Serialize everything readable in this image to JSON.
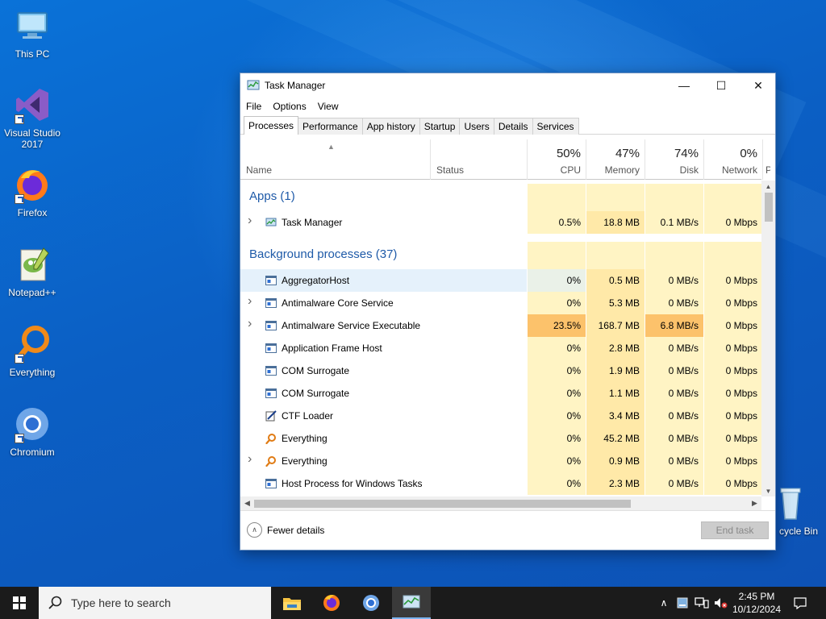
{
  "desktop": {
    "icons": [
      {
        "label": "This PC"
      },
      {
        "label": "Visual Studio 2017"
      },
      {
        "label": "Firefox"
      },
      {
        "label": "Notepad++"
      },
      {
        "label": "Everything"
      },
      {
        "label": "Chromium"
      },
      {
        "label": "cycle Bin"
      }
    ]
  },
  "window": {
    "title": "Task Manager",
    "controls": {
      "minimize": "—",
      "maximize": "☐",
      "close": "✕"
    },
    "menu": [
      "File",
      "Options",
      "View"
    ],
    "tabs": [
      "Processes",
      "Performance",
      "App history",
      "Startup",
      "Users",
      "Details",
      "Services"
    ],
    "active_tab": "Processes",
    "columns": {
      "name": "Name",
      "status": "Status",
      "cpu": {
        "pct": "50%",
        "label": "CPU"
      },
      "memory": {
        "pct": "47%",
        "label": "Memory"
      },
      "disk": {
        "pct": "74%",
        "label": "Disk"
      },
      "network": {
        "pct": "0%",
        "label": "Network"
      },
      "power_partial": "P"
    },
    "groups": {
      "apps": "Apps (1)",
      "background": "Background processes (37)"
    },
    "app_rows": [
      {
        "name": "Task Manager",
        "expandable": true,
        "icon": "taskmgr-icon",
        "cpu": "0.5%",
        "memory": "18.8 MB",
        "disk": "0.1 MB/s",
        "network": "0 Mbps"
      }
    ],
    "bg_rows": [
      {
        "name": "AggregatorHost",
        "expandable": false,
        "icon": "service-icon",
        "cpu": "0%",
        "memory": "0.5 MB",
        "disk": "0 MB/s",
        "network": "0 Mbps",
        "hover": true
      },
      {
        "name": "Antimalware Core Service",
        "expandable": true,
        "icon": "service-icon",
        "cpu": "0%",
        "memory": "5.3 MB",
        "disk": "0 MB/s",
        "network": "0 Mbps"
      },
      {
        "name": "Antimalware Service Executable",
        "expandable": true,
        "icon": "service-icon",
        "cpu": "23.5%",
        "memory": "168.7 MB",
        "disk": "6.8 MB/s",
        "network": "0 Mbps",
        "hot": true
      },
      {
        "name": "Application Frame Host",
        "expandable": false,
        "icon": "service-icon",
        "cpu": "0%",
        "memory": "2.8 MB",
        "disk": "0 MB/s",
        "network": "0 Mbps"
      },
      {
        "name": "COM Surrogate",
        "expandable": false,
        "icon": "service-icon",
        "cpu": "0%",
        "memory": "1.9 MB",
        "disk": "0 MB/s",
        "network": "0 Mbps"
      },
      {
        "name": "COM Surrogate",
        "expandable": false,
        "icon": "service-icon",
        "cpu": "0%",
        "memory": "1.1 MB",
        "disk": "0 MB/s",
        "network": "0 Mbps"
      },
      {
        "name": "CTF Loader",
        "expandable": false,
        "icon": "ctf-icon",
        "cpu": "0%",
        "memory": "3.4 MB",
        "disk": "0 MB/s",
        "network": "0 Mbps"
      },
      {
        "name": "Everything",
        "expandable": false,
        "icon": "everything-icon",
        "cpu": "0%",
        "memory": "45.2 MB",
        "disk": "0 MB/s",
        "network": "0 Mbps"
      },
      {
        "name": "Everything",
        "expandable": true,
        "icon": "everything-icon",
        "cpu": "0%",
        "memory": "0.9 MB",
        "disk": "0 MB/s",
        "network": "0 Mbps"
      },
      {
        "name": "Host Process for Windows Tasks",
        "expandable": false,
        "icon": "service-icon",
        "cpu": "0%",
        "memory": "2.3 MB",
        "disk": "0 MB/s",
        "network": "0 Mbps"
      }
    ],
    "footer": {
      "fewer_details": "Fewer details",
      "end_task": "End task"
    }
  },
  "taskbar": {
    "search_placeholder": "Type here to search",
    "apps": [
      "file-explorer-icon",
      "firefox-icon",
      "chromium-icon",
      "task-manager-icon"
    ],
    "clock_time": "2:45 PM",
    "clock_date": "10/12/2024"
  },
  "colors": {
    "heat_low": "#fff4c4",
    "heat_mid": "#ffe9a8",
    "heat_high": "#fcc26b",
    "accent_blue": "#1e5aa8"
  }
}
